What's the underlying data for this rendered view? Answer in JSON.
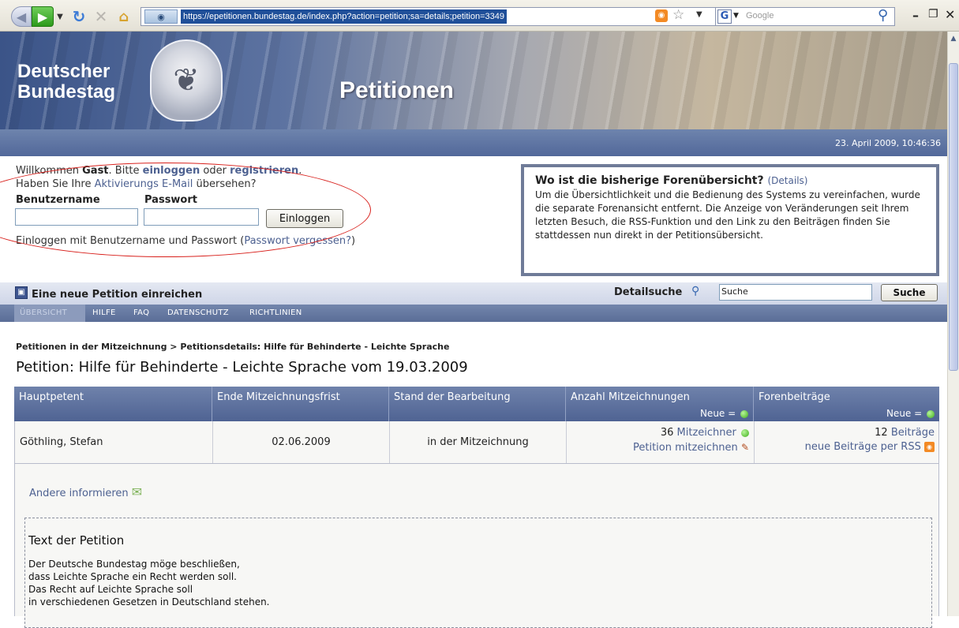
{
  "browser": {
    "url": "https://epetitionen.bundestag.de/index.php?action=petition;sa=details;petition=3349",
    "search_placeholder": "Google",
    "search_engine_letter": "G"
  },
  "banner": {
    "logo_line1": "Deutscher",
    "logo_line2": "Bundestag",
    "title": "Petitionen",
    "datetime": "23. April 2009, 10:46:36"
  },
  "welcome": {
    "pre": "Willkommen ",
    "user": "Gast",
    "mid": ". Bitte ",
    "login_link": "einloggen",
    "or": " oder ",
    "register_link": "registrieren",
    "end": ".",
    "line2_pre": "Haben Sie Ihre ",
    "activation_link": "Aktivierungs E-Mail",
    "line2_post": " übersehen?"
  },
  "login": {
    "username_label": "Benutzername",
    "password_label": "Passwort",
    "username_value": "",
    "password_value": "",
    "button": "Einloggen",
    "note_pre": "Einloggen mit Benutzername und Passwort (",
    "forgot_link": "Passwort vergessen?",
    "note_post": ")"
  },
  "infobox": {
    "title": "Wo ist die bisherige Forenübersicht?",
    "details_link": "(Details)",
    "body": "Um die Übersichtlichkeit und die Bedienung des Systems zu vereinfachen, wurde die separate Forenansicht entfernt. Die Anzeige von Veränderungen seit Ihrem letzten Besuch, die RSS-Funktion und den Link zu den Beiträgen finden Sie stattdessen nun direkt in der Petitionsübersicht."
  },
  "petbar": {
    "new_petition": "Eine neue Petition einreichen",
    "detail_search": "Detailsuche",
    "search_value": "Suche",
    "search_button": "Suche"
  },
  "nav": [
    "ÜBERSICHT",
    "HILFE",
    "FAQ",
    "DATENSCHUTZ",
    "RICHTLINIEN"
  ],
  "breadcrumb": "Petitionen in der Mitzeichnung > Petitionsdetails: Hilfe für Behinderte - Leichte Sprache",
  "page_title": "Petition: Hilfe für Behinderte - Leichte Sprache vom 19.03.2009",
  "table": {
    "headers": [
      "Hauptpetent",
      "Ende Mitzeichnungsfrist",
      "Stand der Bearbeitung",
      "Anzahl Mitzeichnungen",
      "Forenbeiträge"
    ],
    "new_label": "Neue =",
    "petent": "Göthling, Stefan",
    "end_date": "02.06.2009",
    "status": "in der Mitzeichnung",
    "signers_count": "36",
    "signers_link": "Mitzeichner",
    "sign_link": "Petition mitzeichnen",
    "posts_count": "12",
    "posts_link": "Beiträge",
    "rss_link": "neue Beiträge per RSS"
  },
  "share_link": "Andere informieren",
  "petition_text": {
    "heading": "Text der Petition",
    "lines": [
      "Der Deutsche Bundestag möge beschließen,",
      "dass Leichte Sprache ein Recht werden soll.",
      "Das Recht auf Leichte Sprache soll",
      "in verschiedenen Gesetzen in Deutschland stehen."
    ]
  },
  "colors": {
    "accent": "#4d6191",
    "annotation": "#d8201c",
    "new_dot": "#3fae1b",
    "rss": "#f38a24"
  }
}
